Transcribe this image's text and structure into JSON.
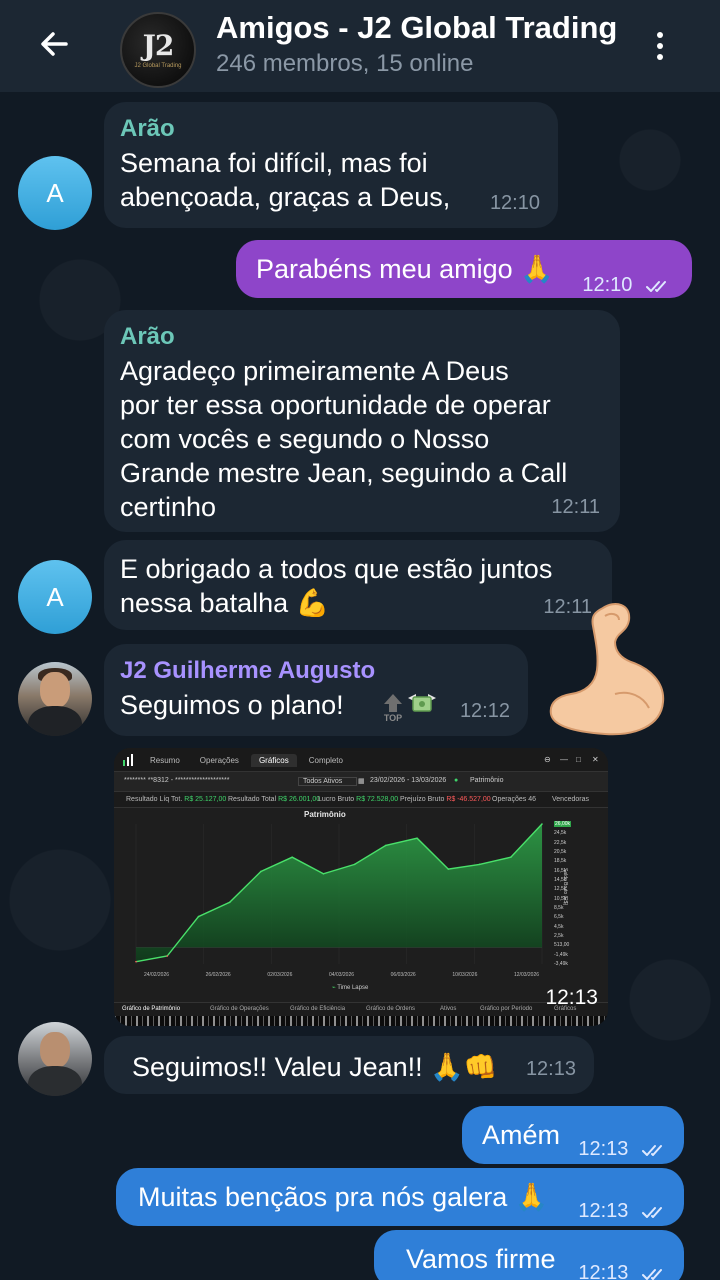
{
  "header": {
    "title": "Amigos - J2 Global Trading",
    "subtitle": "246 membros, 15 online",
    "avatar_logo": "J2",
    "avatar_logo_sub": "J2 Global Trading"
  },
  "messages": [
    {
      "sender": "Arão",
      "text": "Semana foi difícil, mas foi\nabençoada, graças a Deus,",
      "time": "12:10",
      "avatar": "A"
    },
    {
      "text": "Parabéns meu amigo 🙏",
      "time": "12:10",
      "status": "read"
    },
    {
      "sender": "Arão",
      "text": "Agradeço primeiramente A Deus\npor ter essa oportunidade de operar\ncom vocês e segundo o Nosso\nGrande mestre Jean, seguindo a Call\ncertinho",
      "time": "12:11"
    },
    {
      "text": "E obrigado a todos que estão juntos\nnessa batalha 💪",
      "time": "12:11",
      "avatar": "A"
    },
    {
      "sender": "J2 Guilherme Augusto",
      "text": "Seguimos o plano!",
      "time": "12:12"
    },
    {
      "media_time": "12:13"
    },
    {
      "text": "Seguimos!! Valeu Jean!! 🙏👊",
      "time": "12:13"
    },
    {
      "text": "Amém",
      "time": "12:13",
      "status": "read"
    },
    {
      "text": "Muitas bençãos pra nós galera 🙏",
      "time": "12:13",
      "status": "read"
    },
    {
      "text": "Vamos firme",
      "time": "12:13",
      "status": "read"
    }
  ],
  "sticker": {
    "top_label": "TOP"
  },
  "screenshot": {
    "tabs": [
      "Resumo",
      "Operações",
      "Gráficos",
      "Completo"
    ],
    "active_tab": "Gráficos",
    "account": "******** **8312 - ********************",
    "asset_filter": "Todos Ativos",
    "date_range": "23/02/2026 - 13/03/2026",
    "metric": "Patrimônio",
    "stats": [
      {
        "label": "Resultado Líq Tot.",
        "value": "R$ 25.127,00"
      },
      {
        "label": "Resultado Total",
        "value": "R$ 26.001,00"
      },
      {
        "label": "Lucro Bruto",
        "value": "R$ 72.528,00"
      },
      {
        "label": "Prejuízo Bruto",
        "value": "R$ -46.527,00"
      },
      {
        "label": "Operações",
        "value": "46"
      },
      {
        "label": "Vencedoras",
        "value": ""
      }
    ],
    "bottom_tabs": [
      "Gráfico de Patrimônio",
      "Gráfico de Operações",
      "Gráfico de Eficiência",
      "Gráfico de Ordens",
      "Ativos",
      "Gráfico por Período",
      "Gráficos"
    ],
    "chart_data": {
      "type": "area",
      "title": "Patrimônio",
      "ylabel": "Saldo Bruto (R$)",
      "legend": "Time Lapse",
      "x_ticks": [
        "24/02/2026",
        "26/02/2026",
        "02/03/2026",
        "04/03/2026",
        "06/03/2026",
        "10/03/2026",
        "12/03/2026"
      ],
      "y_ticks": [
        "26,00k",
        "24,5k",
        "22,5k",
        "20,5k",
        "18,5k",
        "16,5k",
        "14,5k",
        "12,5k",
        "10,5k",
        "8,5k",
        "6,5k",
        "4,5k",
        "2,5k",
        "513,00",
        "-1,49k",
        "-3,49k"
      ],
      "ylim": [
        -3490,
        26000
      ],
      "x": [
        0,
        1,
        2,
        3,
        4,
        5,
        6,
        7,
        8,
        9,
        10,
        11,
        12,
        13
      ],
      "values": [
        -3000,
        -1800,
        6500,
        9500,
        16000,
        19000,
        15500,
        17500,
        21500,
        23000,
        16500,
        17500,
        19000,
        26000
      ],
      "last_label": "26,00k"
    }
  }
}
